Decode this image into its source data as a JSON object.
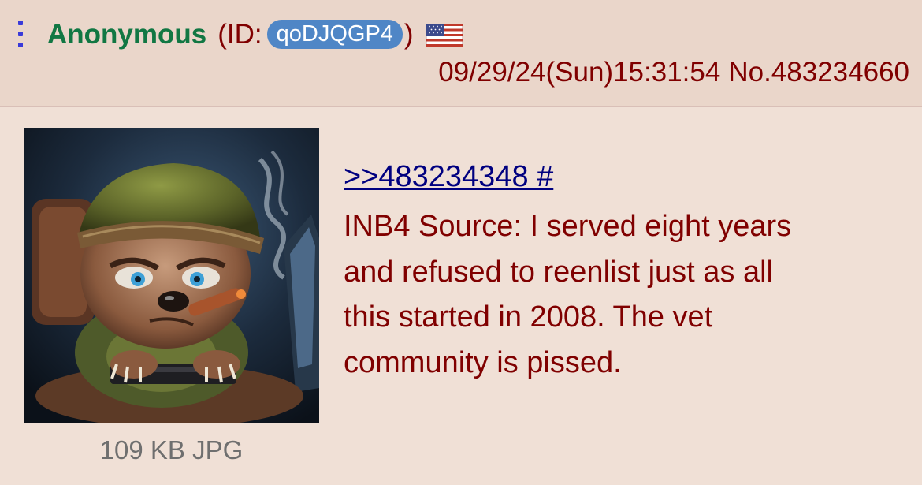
{
  "post": {
    "name": "Anonymous",
    "id_prefix": "(ID:",
    "id_value": "qoDJQGP4",
    "id_suffix": ")",
    "flag_icon": "us-flag-icon",
    "date": "09/29/24(Sun)15:31:54",
    "post_number": "No.483234660",
    "quote_link": ">>483234348 #",
    "body_lines": [
      "INB4 Source: I served eight years",
      "and refused to reenlist just as all",
      "this started in 2008. The vet",
      "community is pissed."
    ],
    "file_info": "109 KB JPG"
  },
  "colors": {
    "background": "#f0e0d6",
    "header_background": "#ead6ca",
    "name": "#117743",
    "text": "#800000",
    "link": "#000080",
    "id_badge": "#4f86c6",
    "menu": "#3a3ad9",
    "file_info": "#6f6f6f"
  }
}
